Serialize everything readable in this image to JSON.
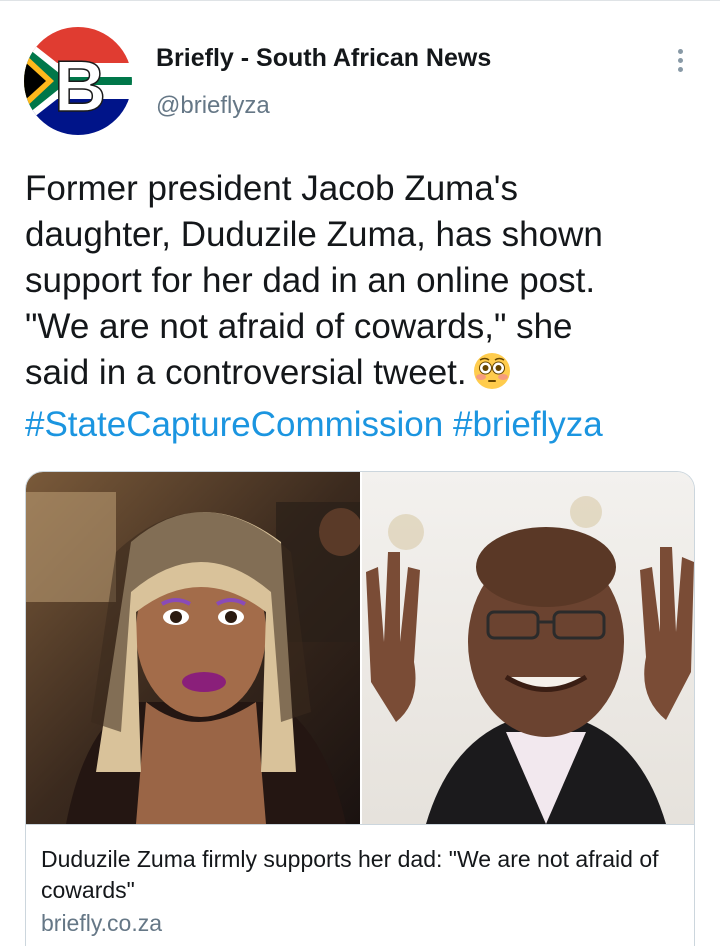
{
  "account": {
    "display_name": "Briefly - South African News",
    "handle": "@brieflyza",
    "avatar_letter": "B"
  },
  "tweet": {
    "lines": [
      "Former president Jacob Zuma's",
      "daughter, Duduzile Zuma, has shown",
      "support for her dad in an online post.",
      "\"We are not afraid of cowards,\" she",
      "said in a controversial tweet."
    ],
    "emoji": "flushed-face",
    "hashtags": [
      "#StateCaptureCommission",
      "#brieflyza"
    ]
  },
  "card": {
    "title": "Duduzile Zuma firmly supports her dad: \"We are not afraid of cowards\"",
    "domain": "briefly.co.za"
  },
  "colors": {
    "link": "#1b95e0",
    "text": "#14171a",
    "secondary": "#657786",
    "border": "#ccd6dd"
  }
}
